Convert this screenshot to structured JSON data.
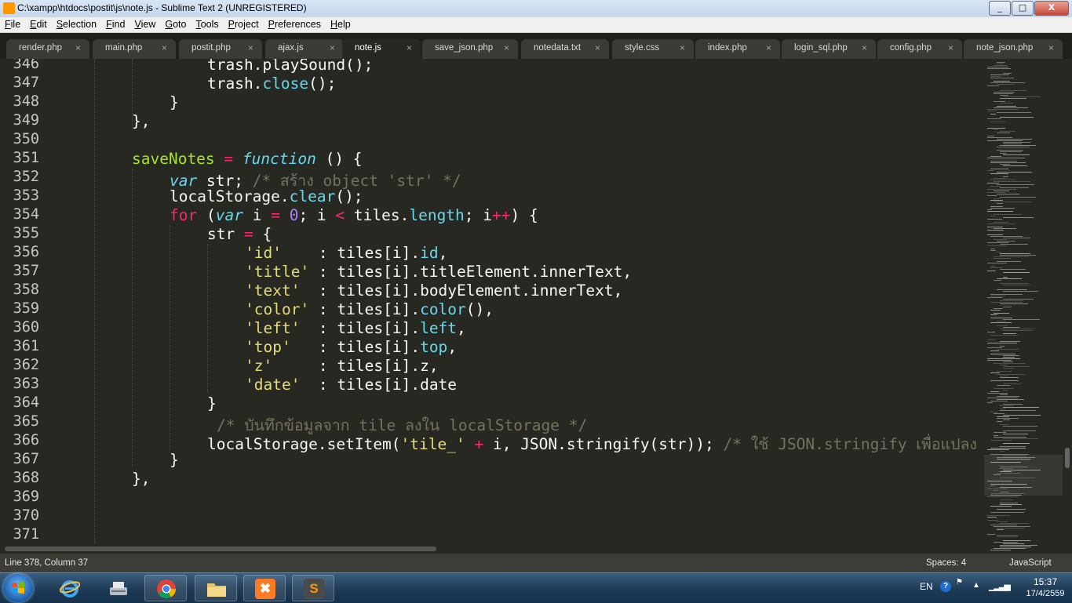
{
  "window": {
    "title": "C:\\xampp\\htdocs\\postit\\js\\note.js - Sublime Text 2 (UNREGISTERED)",
    "minimize_label": "_",
    "maximize_label": "□",
    "close_label": "X"
  },
  "menu": [
    "File",
    "Edit",
    "Selection",
    "Find",
    "View",
    "Goto",
    "Tools",
    "Project",
    "Preferences",
    "Help"
  ],
  "tabs": [
    {
      "label": "render.php",
      "active": false
    },
    {
      "label": "main.php",
      "active": false
    },
    {
      "label": "postit.php",
      "active": false
    },
    {
      "label": "ajax.js",
      "active": false
    },
    {
      "label": "note.js",
      "active": true
    },
    {
      "label": "save_json.php",
      "active": false
    },
    {
      "label": "notedata.txt",
      "active": false
    },
    {
      "label": "style.css",
      "active": false
    },
    {
      "label": "index.php",
      "active": false
    },
    {
      "label": "login_sql.php",
      "active": false
    },
    {
      "label": "config.php",
      "active": false
    },
    {
      "label": "note_json.php",
      "active": false
    }
  ],
  "tab_close_glyph": "×",
  "line_numbers": [
    "346",
    "347",
    "348",
    "349",
    "350",
    "351",
    "352",
    "353",
    "354",
    "355",
    "356",
    "357",
    "358",
    "359",
    "360",
    "361",
    "362",
    "363",
    "364",
    "365",
    "366",
    "367",
    "368",
    "369",
    "370",
    "371"
  ],
  "code": {
    "l346": "trash.playSound();",
    "l347_a": "trash.",
    "l347_b": "close",
    "l347_c": "();",
    "l348": "}",
    "l349": "},",
    "l351_a": "saveNotes",
    "l351_b": " = ",
    "l351_c": "function",
    "l351_d": " () {",
    "l352_a": "var",
    "l352_b": " str; ",
    "l352_c": "/* สร้าง object 'str' */",
    "l353_a": "localStorage.",
    "l353_b": "clear",
    "l353_c": "();",
    "l354_a": "for",
    "l354_b": " (",
    "l354_c": "var",
    "l354_d": " i ",
    "l354_e": "=",
    "l354_f": " ",
    "l354_g": "0",
    "l354_h": "; i ",
    "l354_i": "<",
    "l354_j": " tiles.",
    "l354_k": "length",
    "l354_l": "; i",
    "l354_m": "++",
    "l354_n": ") {",
    "l355_a": "str ",
    "l355_b": "=",
    "l355_c": " {",
    "l356_a": "'id'",
    "l356_b": "    : tiles[i].",
    "l356_c": "id",
    "l356_d": ",",
    "l357_a": "'title'",
    "l357_b": " : tiles[i].titleElement.innerText,",
    "l358_a": "'text'",
    "l358_b": "  : tiles[i].bodyElement.innerText,",
    "l359_a": "'color'",
    "l359_b": " : tiles[i].",
    "l359_c": "color",
    "l359_d": "(),",
    "l360_a": "'left'",
    "l360_b": "  : tiles[i].",
    "l360_c": "left",
    "l360_d": ",",
    "l361_a": "'top'",
    "l361_b": "   : tiles[i].",
    "l361_c": "top",
    "l361_d": ",",
    "l362_a": "'z'",
    "l362_b": "     : tiles[i].z,",
    "l363_a": "'date'",
    "l363_b": "  : tiles[i].date",
    "l364": "}",
    "l365": "/* บันทึกข้อมูลจาก tile ลงใน localStorage */",
    "l366_a": "localStorage.setItem(",
    "l366_b": "'tile_'",
    "l366_c": " ",
    "l366_d": "+",
    "l366_e": " i, JSON.stringify(str)); ",
    "l366_f": "/* ใช้ JSON.stringify เพื่อแปลง",
    "l367": "}",
    "l368": "},"
  },
  "status": {
    "position": "Line 378, Column 37",
    "spaces": "Spaces: 4",
    "syntax": "JavaScript"
  },
  "taskbar": {
    "apps": [
      "internet-explorer",
      "scanner",
      "chrome",
      "file-explorer",
      "xampp",
      "sublime-text"
    ],
    "xampp_glyph": "✖",
    "sublime_glyph": "S",
    "tray_lang": "EN",
    "tray_help": "?",
    "time": "15:37",
    "date": "17/4/2559"
  },
  "colors": {
    "background": "#272822",
    "keyword": "#f92672",
    "function": "#a6e22e",
    "string": "#e6db74",
    "number": "#ae81ff",
    "comment": "#75715e",
    "builtin": "#66d9ef"
  }
}
